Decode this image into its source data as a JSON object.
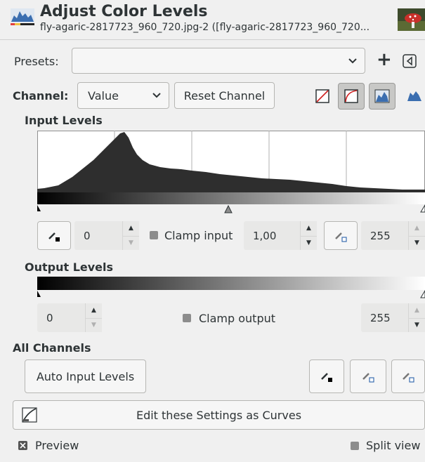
{
  "header": {
    "title": "Adjust Color Levels",
    "subtitle": "fly-agaric-2817723_960_720.jpg-2 ([fly-agaric-2817723_960_720..."
  },
  "presets": {
    "label": "Presets:",
    "value": ""
  },
  "channel": {
    "label": "Channel:",
    "value": "Value",
    "reset_label": "Reset Channel"
  },
  "input_levels": {
    "heading": "Input Levels",
    "low_value": "0",
    "clamp_label": "Clamp input",
    "gamma_value": "1,00",
    "high_value": "255"
  },
  "output_levels": {
    "heading": "Output Levels",
    "low_value": "0",
    "clamp_label": "Clamp output",
    "high_value": "255"
  },
  "all_channels": {
    "heading": "All Channels",
    "auto_label": "Auto Input Levels"
  },
  "curves": {
    "label": "Edit these Settings as Curves"
  },
  "footer": {
    "preview_label": "Preview",
    "split_label": "Split view"
  },
  "colors": {
    "background": "#f0f0f0",
    "histogram": "#2e2e2e",
    "button": "#f6f6f6",
    "field": "#e8e8e7"
  }
}
